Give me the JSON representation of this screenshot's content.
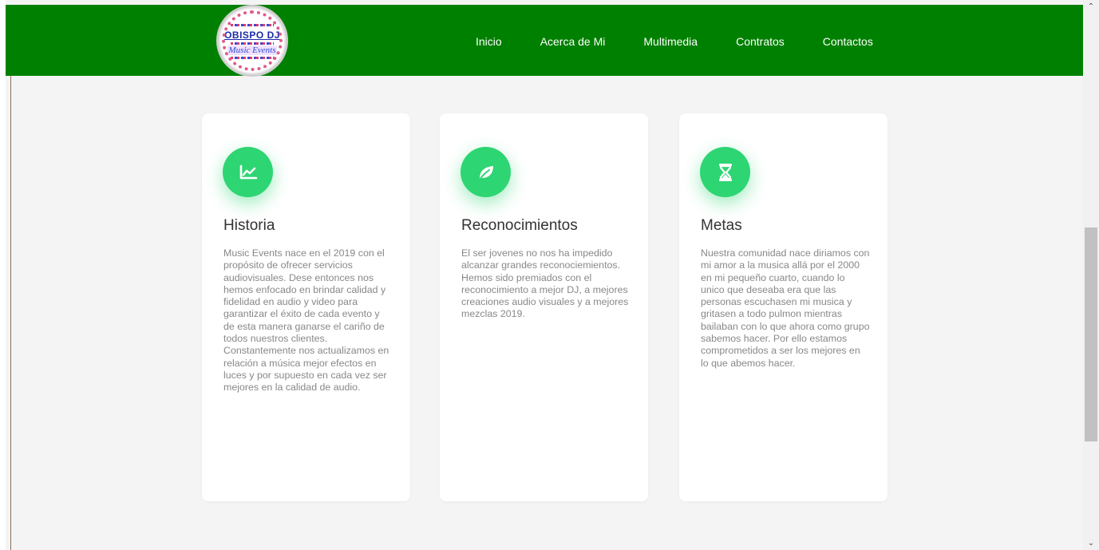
{
  "nav": {
    "logo": {
      "title": "OBISPO DJ",
      "subtitle": "Music Events"
    },
    "links": [
      "Inicio",
      "Acerca de Mi",
      "Multimedia",
      "Contratos",
      "Contactos"
    ]
  },
  "cards": [
    {
      "icon": "chart-line-icon",
      "title": "Historia",
      "text": "Music Events nace en el 2019 con el propósito de ofrecer servicios audiovisuales. Dese entonces nos hemos enfocado en brindar calidad y fidelidad en audio y video para garantizar el éxito de cada evento y de esta manera ganarse el cariño de todos nuestros clientes. Constantemente nos actualizamos en relación a música mejor efectos en luces y por supuesto en cada vez ser mejores en la calidad de audio."
    },
    {
      "icon": "leaf-icon",
      "title": "Reconocimientos",
      "text": "El ser jovenes no nos ha impedido alcanzar grandes reconociemientos. Hemos sido premiados con el reconocimiento a mejor DJ, a mejores creaciones audio visuales y a mejores mezclas 2019."
    },
    {
      "icon": "hourglass-icon",
      "title": "Metas",
      "text": "Nuestra comunidad nace diriamos con mi amor a la musica allá por el 2000 en mi pequeño cuarto, cuando lo unico que deseaba era que las personas escuchasen mi musica y gritasen a todo pulmon mientras bailaban con lo que ahora como grupo sabemos hacer. Por ello estamos comprometidos a ser los mejores en lo que abemos hacer."
    }
  ],
  "colors": {
    "navbar": "#008000",
    "icon_bg": "#2ed573",
    "page_bg": "#f4f4f4"
  }
}
